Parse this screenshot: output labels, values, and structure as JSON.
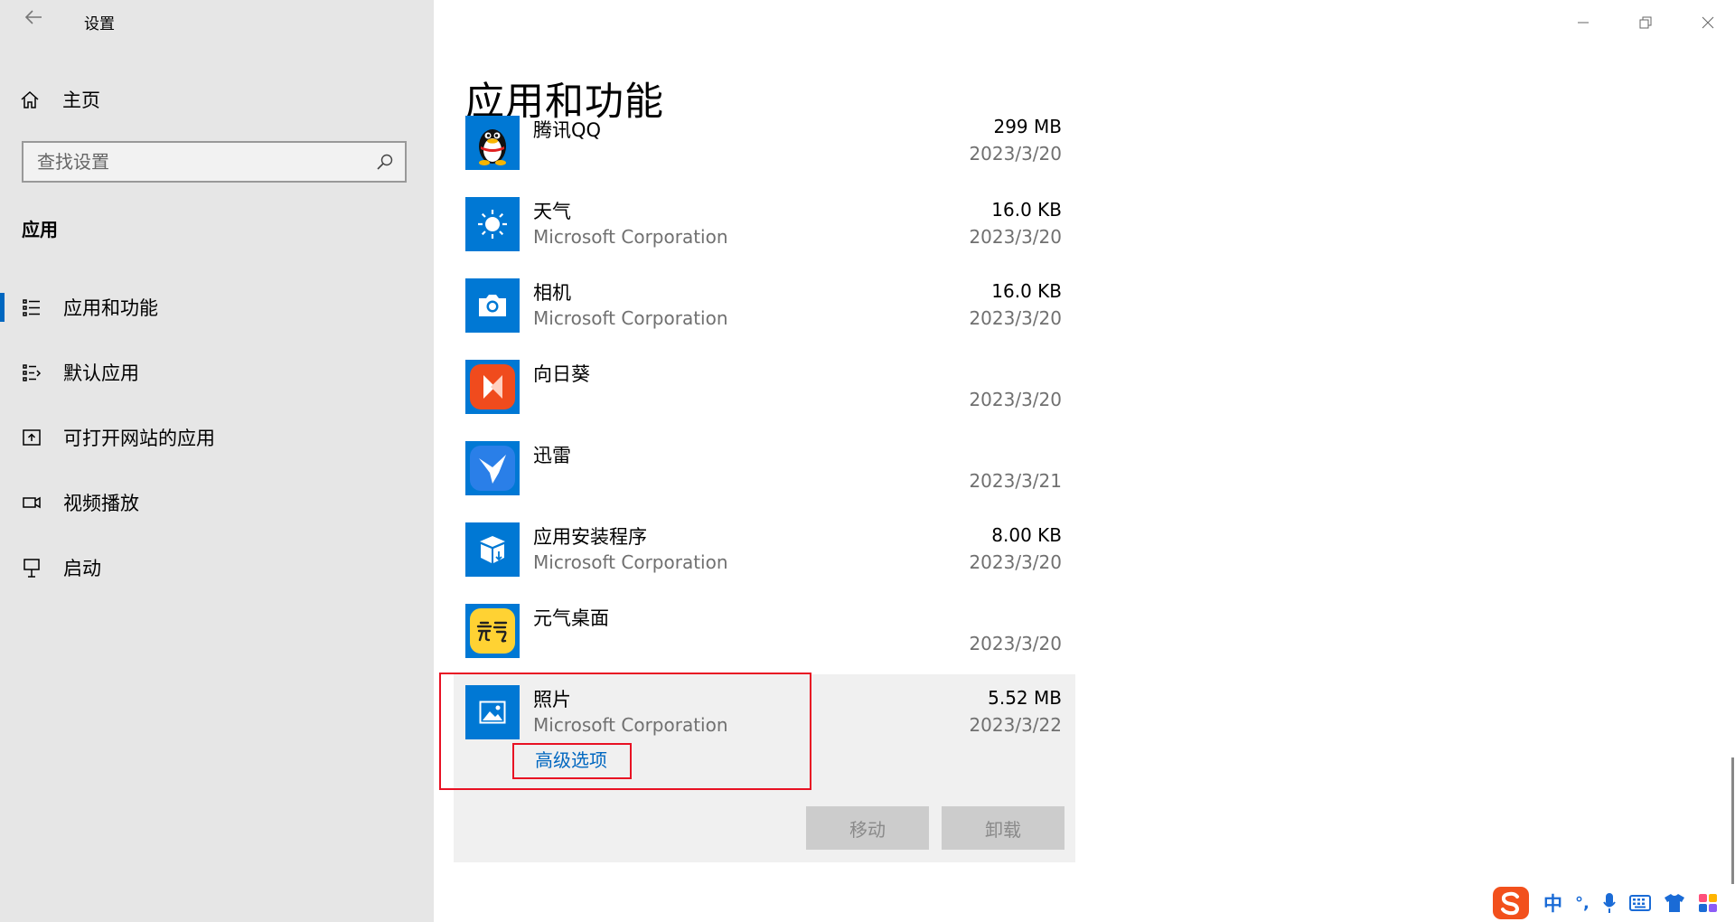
{
  "window": {
    "title": "设置"
  },
  "sidebar": {
    "home_label": "主页",
    "search_placeholder": "查找设置",
    "section_title": "应用",
    "items": [
      {
        "label": "应用和功能",
        "icon": "apps-list-icon",
        "selected": true
      },
      {
        "label": "默认应用",
        "icon": "default-apps-icon"
      },
      {
        "label": "可打开网站的应用",
        "icon": "apps-for-websites-icon"
      },
      {
        "label": "视频播放",
        "icon": "video-playback-icon"
      },
      {
        "label": "启动",
        "icon": "startup-icon"
      }
    ]
  },
  "main": {
    "title": "应用和功能",
    "apps": [
      {
        "name": "腾讯QQ",
        "publisher": "",
        "size": "299 MB",
        "date": "2023/3/20",
        "icon": "qq-penguin-icon"
      },
      {
        "name": "天气",
        "publisher": "Microsoft Corporation",
        "size": "16.0 KB",
        "date": "2023/3/20",
        "icon": "weather-sun-icon"
      },
      {
        "name": "相机",
        "publisher": "Microsoft Corporation",
        "size": "16.0 KB",
        "date": "2023/3/20",
        "icon": "camera-icon"
      },
      {
        "name": "向日葵",
        "publisher": "",
        "size": "",
        "date": "2023/3/20",
        "icon": "sunlogin-icon"
      },
      {
        "name": "迅雷",
        "publisher": "",
        "size": "",
        "date": "2023/3/21",
        "icon": "xunlei-bird-icon"
      },
      {
        "name": "应用安装程序",
        "publisher": "Microsoft Corporation",
        "size": "8.00 KB",
        "date": "2023/3/20",
        "icon": "app-installer-box-icon"
      },
      {
        "name": "元气桌面",
        "publisher": "",
        "size": "",
        "date": "2023/3/20",
        "icon": "yuanqi-desktop-icon"
      },
      {
        "name": "照片",
        "publisher": "Microsoft Corporation",
        "size": "5.52 MB",
        "date": "2023/3/22",
        "icon": "photos-icon"
      }
    ],
    "selected": {
      "advanced_link": "高级选项",
      "move_label": "移动",
      "uninstall_label": "卸载"
    }
  },
  "ime": {
    "mode_label": "中",
    "punct_label": "°,"
  },
  "colors": {
    "accent": "#0067c0",
    "highlight": "#e81123",
    "sidebar_bg": "#e6e6e6",
    "selected_bg": "#f0f0f0"
  }
}
